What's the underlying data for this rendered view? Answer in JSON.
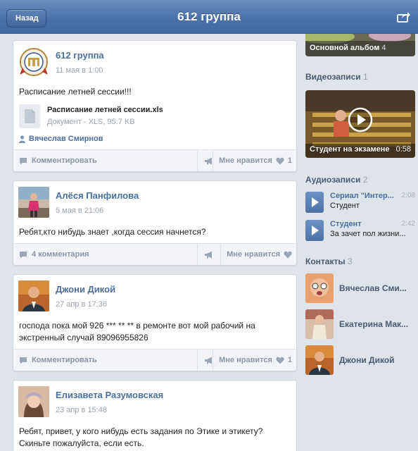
{
  "topbar": {
    "title": "612 группа",
    "back_label": "Назад",
    "share_icon": "share-icon"
  },
  "posts": [
    {
      "author": "612 группа",
      "date": "11 мая в 1:00",
      "text": "Расписание летней сессии!!!",
      "attachment": {
        "name": "Расписание летней сессии.xls",
        "meta": "Документ - XLS, 95.7 KB"
      },
      "signer": "Вячеслав Смирнов",
      "comment_label": "Комментировать",
      "like_label": "Мне нравится",
      "like_count": "1"
    },
    {
      "author": "Алёся Панфилова",
      "date": "5 мая в 21:06",
      "text": "Ребят,кто нибудь знает ,когда сессия начнется?",
      "comment_label": "4 комментария",
      "like_label": "Мне нравится",
      "like_count": ""
    },
    {
      "author": "Джони Дикой",
      "date": "27 апр в 17:36",
      "text": "господа пока мой 926 *** ** ** в ремонте вот мой рабочий на экстренный случай 89096955826",
      "comment_label": "Комментировать",
      "like_label": "Мне нравится",
      "like_count": "1"
    },
    {
      "author": "Елизавета Разумовская",
      "date": "23 апр в 15:48",
      "text": "Ребят, привет, у кого нибудь есть задания по Этике и этикету? Скиньте пожалуйста, если есть."
    }
  ],
  "sidebar": {
    "album": {
      "label": "Основной альбом",
      "count": "4"
    },
    "videos": {
      "title": "Видеозаписи",
      "count": "1",
      "caption": "Студент на экзамене",
      "duration": "0:58"
    },
    "audios": {
      "title": "Аудиозаписи",
      "count": "2",
      "items": [
        {
          "title": "Сериал \"Интер...",
          "artist": "Студент",
          "duration": "2:08"
        },
        {
          "title": "Студент",
          "artist": "За зачет пол жизни...",
          "duration": "2:42"
        }
      ]
    },
    "contacts": {
      "title": "Контакты",
      "count": "3",
      "items": [
        {
          "name": "Вячеслав Сми..."
        },
        {
          "name": "Екатерина Мак..."
        },
        {
          "name": "Джони Дикой"
        }
      ]
    }
  },
  "colors": {
    "topbar": "#4a72a8",
    "link": "#4a6f9d",
    "muted": "#9aa3ad",
    "background": "#dfe3ea"
  }
}
